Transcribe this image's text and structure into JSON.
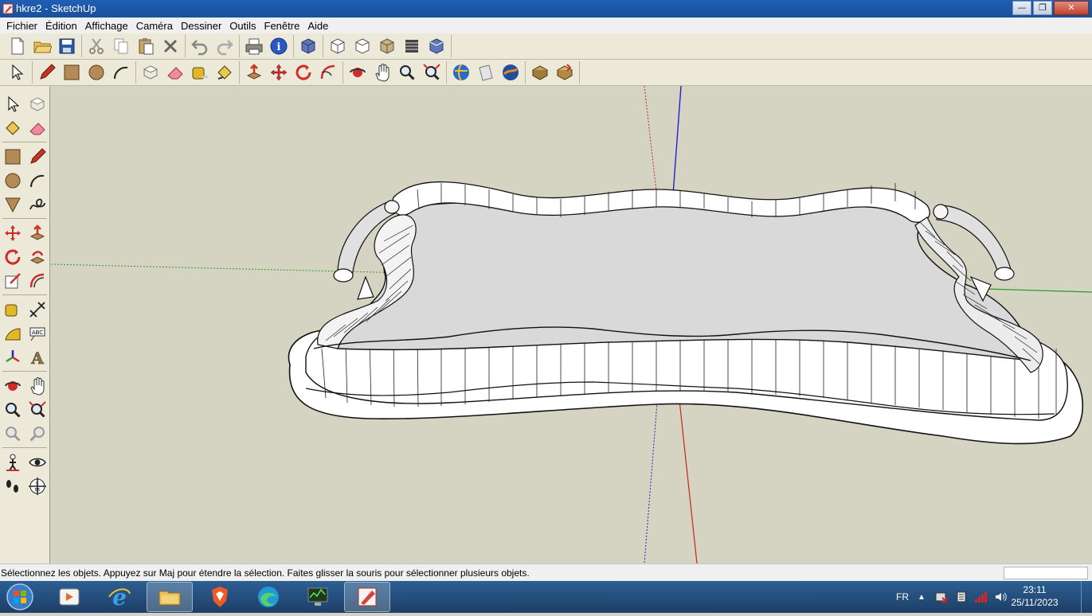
{
  "window": {
    "title": "hkre2 - SketchUp",
    "min": "—",
    "max": "❐",
    "close": "✕"
  },
  "menu": [
    "Fichier",
    "Édition",
    "Affichage",
    "Caméra",
    "Dessiner",
    "Outils",
    "Fenêtre",
    "Aide"
  ],
  "toolbar1_icons": [
    "new-file-icon",
    "open-folder-icon",
    "save-icon",
    "cut-icon",
    "copy-icon",
    "paste-icon",
    "delete-icon",
    "undo-icon",
    "redo-icon",
    "print-icon",
    "model-info-icon",
    "iso-view-icon",
    "top-view-icon",
    "front-view-icon",
    "right-view-icon",
    "back-view-icon",
    "left-view-icon"
  ],
  "toolbar2_icons": [
    "select-icon",
    "pencil-icon",
    "rectangle-icon",
    "circle-icon",
    "arc-icon",
    "make-component-icon",
    "eraser-icon",
    "tape-measure-icon",
    "paint-bucket-icon",
    "push-pull-icon",
    "move-icon",
    "rotate-icon",
    "follow-me-icon",
    "orbit-icon",
    "pan-icon",
    "zoom-icon",
    "zoom-extents-icon",
    "get-models-icon",
    "share-model-icon",
    "google-earth-icon",
    "components-icon",
    "warehouse-icon"
  ],
  "status": {
    "text": "Sélectionnez les objets. Appuyez sur Maj pour étendre la sélection. Faites glisser la souris pour sélectionner plusieurs objets."
  },
  "taskbar": {
    "lang": "FR",
    "time": "23:11",
    "date": "25/11/2023"
  },
  "colors": {
    "viewport": "#d5d3c2",
    "axis_red": "#cc2222",
    "axis_green": "#2aa02a",
    "axis_blue": "#2222cc",
    "tray_face": "#d8d8d8"
  }
}
